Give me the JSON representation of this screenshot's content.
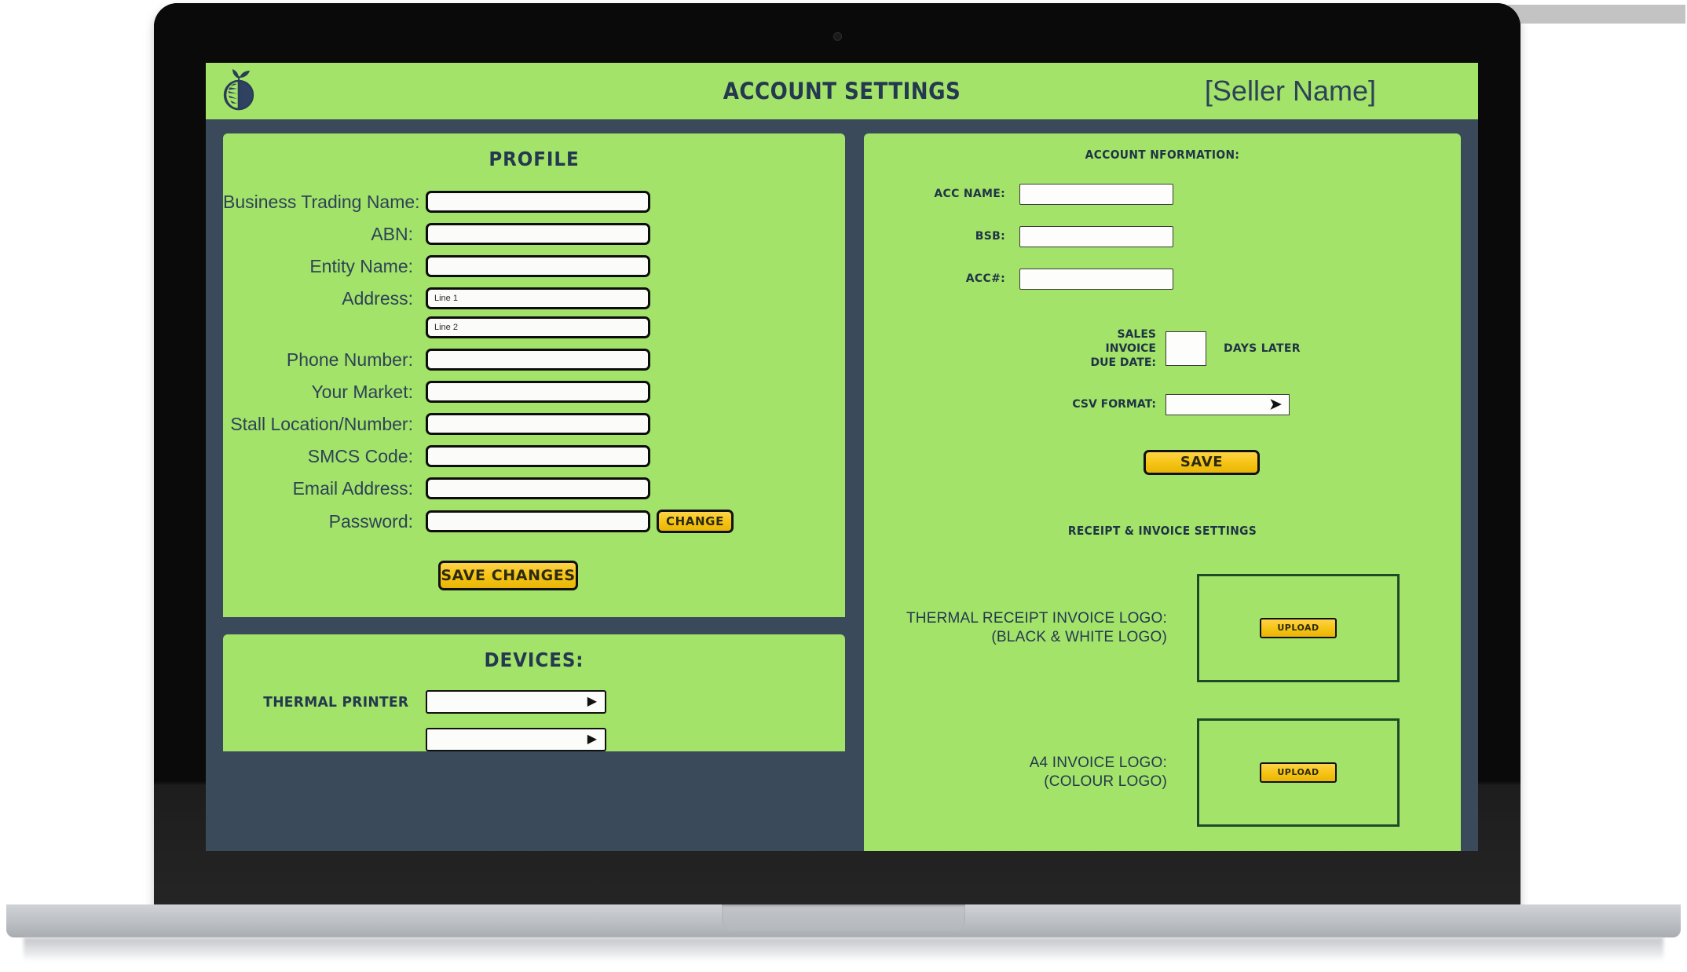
{
  "app": {
    "header": {
      "logo_icon": "citrus-fruit-logo-icon",
      "title": "ACCOUNT SETTINGS",
      "seller": "[Seller Name]"
    },
    "colors": {
      "panel_green": "#A3E369",
      "screen_background": "#3A4A5A",
      "label_navy": "#2E4257",
      "button_yellow": "#F7C518",
      "logo_box_border": "#1F4A2A"
    }
  },
  "profile": {
    "title": "PROFILE",
    "fields": [
      {
        "label": "Business Trading Name:",
        "value": "",
        "placeholder": ""
      },
      {
        "label": "ABN:",
        "value": "",
        "placeholder": ""
      },
      {
        "label": "Entity Name:",
        "value": "",
        "placeholder": ""
      },
      {
        "label": "Address:",
        "value": "",
        "placeholder": "Line 1"
      },
      {
        "label": "",
        "value": "",
        "placeholder": "Line 2"
      },
      {
        "label": "Phone Number:",
        "value": "",
        "placeholder": ""
      },
      {
        "label": "Your Market:",
        "value": "",
        "placeholder": ""
      },
      {
        "label": "Stall Location/Number:",
        "value": "",
        "placeholder": ""
      },
      {
        "label": "SMCS Code:",
        "value": "",
        "placeholder": ""
      },
      {
        "label": "Email Address:",
        "value": "",
        "placeholder": ""
      },
      {
        "label": "Password:",
        "value": "",
        "placeholder": ""
      }
    ],
    "change_button": "CHANGE",
    "save_button": "SAVE CHANGES"
  },
  "devices": {
    "title": "DEVICES:",
    "rows": [
      {
        "label": "THERMAL PRINTER",
        "selected": "",
        "caret_icon": "caret-right-solid-icon"
      },
      {
        "label": "",
        "selected": "",
        "caret_icon": "caret-right-solid-icon"
      }
    ]
  },
  "account_information": {
    "title": "ACCOUNT NFORMATION:",
    "fields": [
      {
        "label": "ACC NAME:",
        "value": ""
      },
      {
        "label": "BSB:",
        "value": ""
      },
      {
        "label": "ACC#:",
        "value": ""
      }
    ],
    "due_date": {
      "label_line1": "SALES INVOICE",
      "label_line2": "DUE DATE:",
      "value": "",
      "suffix": "DAYS LATER"
    },
    "csv_format": {
      "label": "CSV FORMAT:",
      "selected": "",
      "caret_icon": "arrow-right-bold-icon"
    },
    "save_button": "SAVE"
  },
  "receipt_invoice_settings": {
    "title": "RECEIPT & INVOICE SETTINGS",
    "items": [
      {
        "label_line1": "THERMAL RECEIPT INVOICE LOGO:",
        "label_line2": "(BLACK & WHITE LOGO)",
        "upload_button": "UPLOAD"
      },
      {
        "label_line1": "A4 INVOICE LOGO:",
        "label_line2": "(COLOUR LOGO)",
        "upload_button": "UPLOAD"
      }
    ]
  }
}
